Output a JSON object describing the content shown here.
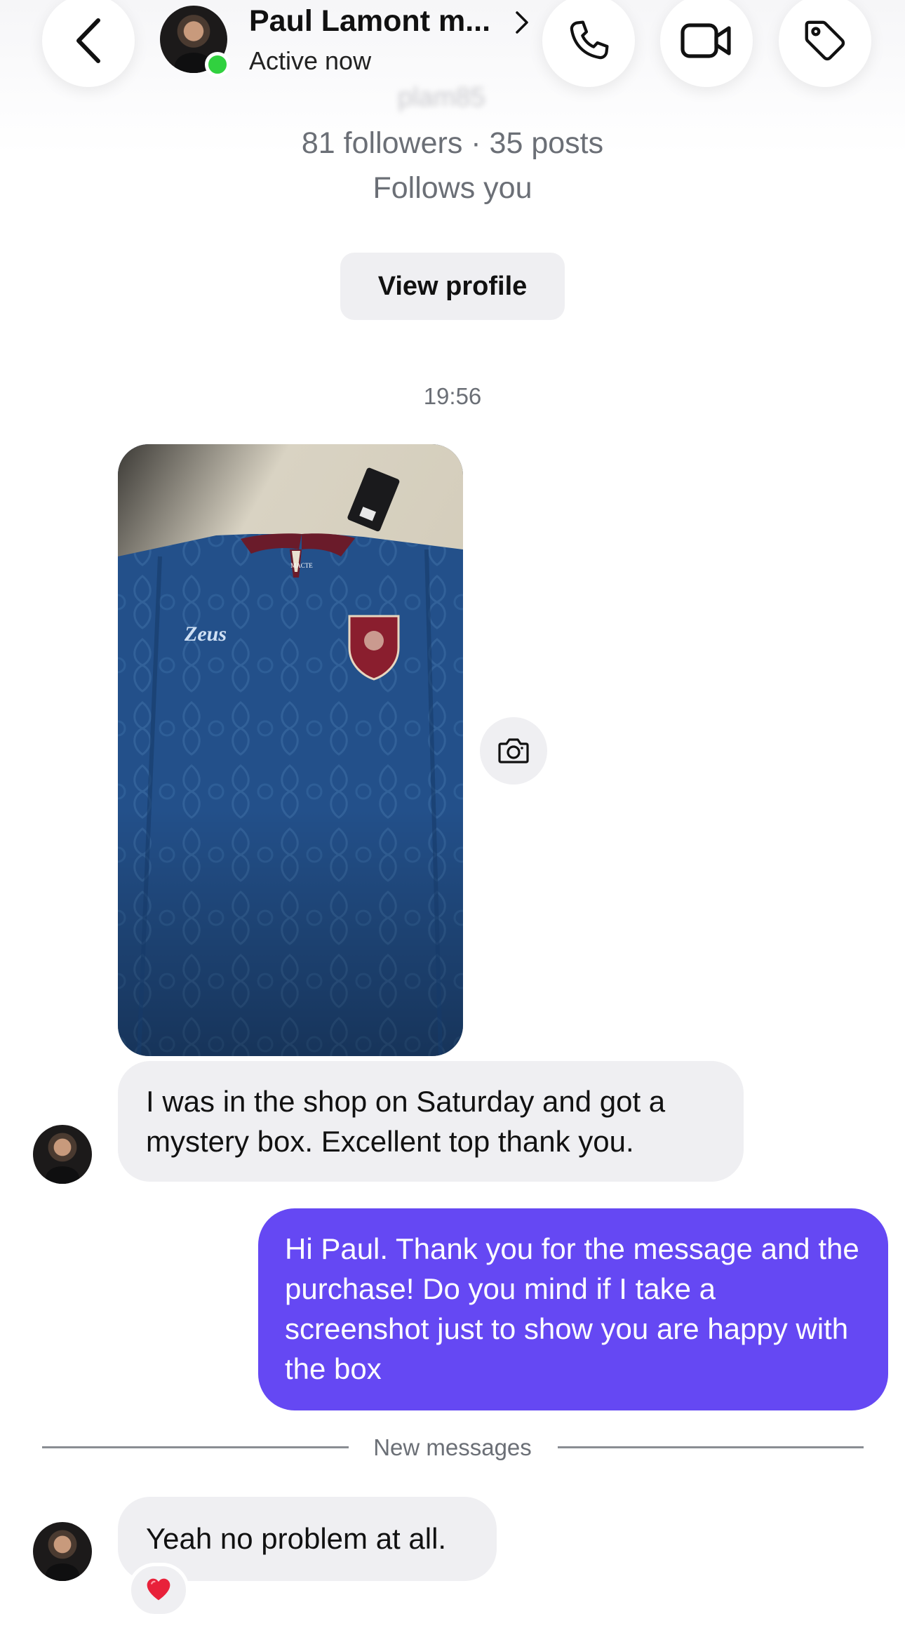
{
  "header": {
    "contact_name": "Paul Lamont m...",
    "status": "Active now",
    "handle": "plam85",
    "icons": {
      "back": "back-chevron-icon",
      "name_chevron": "chevron-right-icon",
      "call": "phone-icon",
      "video": "video-camera-icon",
      "tag": "tag-icon"
    },
    "online_color": "#31d13f"
  },
  "profile": {
    "followers_line": "81 followers · 35 posts",
    "follows_line": "Follows you",
    "view_profile_label": "View profile"
  },
  "thread": {
    "timestamp": "19:56",
    "photo_message": {
      "icon": "camera-icon"
    },
    "messages": [
      {
        "sender": "contact",
        "text": "I was in the shop on Saturday and got a mystery box. Excellent top thank you."
      },
      {
        "sender": "me",
        "text": "Hi Paul. Thank you for the message and the purchase! Do you mind if I take a screenshot just to show you are happy with the box"
      },
      {
        "sender": "contact",
        "text": "Yeah no problem at all.",
        "reaction": "❤️"
      }
    ],
    "new_messages_label": "New messages"
  },
  "colors": {
    "outgoing_bubble": "#6548f3",
    "incoming_bubble": "#efeff2",
    "secondary_text": "#6b6f76"
  }
}
